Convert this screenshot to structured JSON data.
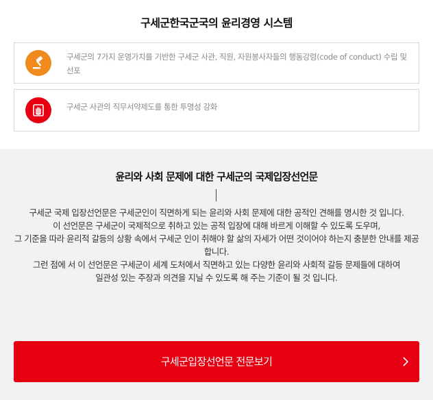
{
  "ethics_section": {
    "title": "구세군한국군국의 윤리경영 시스템",
    "cards": [
      {
        "icon": "gavel-icon",
        "icon_color": "#f08a1c",
        "text": "구세군의 7가지 운영가치를 기반한 구세군 사관, 직원, 자원봉사자들의 행동강령(code of conduct) 수립 및 선포"
      },
      {
        "icon": "hand-stop-icon",
        "icon_color": "#e60012",
        "text": "구세군 사관의 직무서약제도를 통한 투명성 강화"
      }
    ]
  },
  "declaration_section": {
    "title": "윤리와 사회 문제에 대한 구세군의 국제입장선언문",
    "paragraphs": [
      "구세군 국제 입장선언문은 구세군인이 직면하게 되는 윤리와 사회 문제에 대한 공적인 견해를 명시한 것 입니다.",
      "이 선언문은 구세군이 국제적으로 취하고 있는 공적 입장에 대해 바르게 이해할 수 있도록 도우며,",
      "그 기준을 따라 윤리적 갈등의 상황 속에서 구세군 인이 취해야 할 삶의 자세가 어떤 것이어야 하는지 충분한 안내를 제공합니다.",
      "그런 점에 서 이 선언문은 구세군이 세계 도처에서 직면하고 있는 다양한 윤리와 사회적 갈등 문제들에 대하여",
      "일관성 있는 주장과 의견을 지닐 수 있도록 해 주는 기준이 될 것 입니다."
    ],
    "cta": {
      "label": "구세군입장선언문 전문보기",
      "icon": "chevron-right-icon",
      "color": "#e60012"
    }
  }
}
